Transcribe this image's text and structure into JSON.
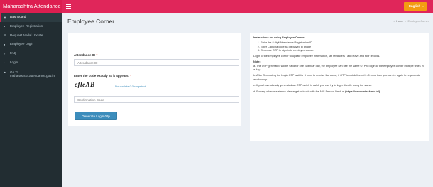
{
  "header": {
    "brand": "Maharashtra Attendance",
    "language": "English"
  },
  "sidebar": {
    "items": [
      {
        "label": "Dashboard",
        "icon": "dashboard-icon"
      },
      {
        "label": "Employee Registration",
        "icon": "users-icon"
      },
      {
        "label": "Request Nodal Update",
        "icon": "list-icon"
      },
      {
        "label": "Employee Login",
        "icon": "user-icon"
      },
      {
        "label": "FAQ",
        "icon": "question-icon"
      },
      {
        "label": "Login",
        "icon": "chevron-icon"
      },
      {
        "label_line1": "Go To",
        "label_line2": "maharashtra.attendance.gov.in",
        "icon": "globe-icon"
      }
    ]
  },
  "page": {
    "title": "Employee Corner",
    "breadcrumb": {
      "home": "Home",
      "current": "Employee Corner"
    }
  },
  "form": {
    "attendance_id_label": "Attendance ID",
    "attendance_id_placeholder": "Attendance ID",
    "captcha_label": "Enter the code exactly as it appears:",
    "captcha_text": "efleAB",
    "captcha_refresh": "Not readable? Change text",
    "confirmation_placeholder": "Confirmation Code",
    "submit_label": "Generate Login Otp",
    "required_mark": "*"
  },
  "instructions": {
    "title": "Instructions for using Employee Corner:",
    "steps": [
      "Enter the 8 digit Attendance/Registration ID.",
      "Enter Captcha code as displayed in image",
      "Generate OTP to sign in to employee corner."
    ],
    "login_text": "Login to the Employee corner to update employee information, set reminders , add leave and tour records.",
    "note_title": "Note:",
    "note_a": "a. The OTP generated will be valid for one calendar day, the employee can use the same OTP to login to the employee corner multiple times in a day.",
    "note_b": "b. After Generating the Login OTP wait for 5 mins to receive the same, if OTP is not delivered in 5 mins then you can try again to regenerate another otp.",
    "note_c": "c. If you have already generated an OTP which is valid, you can try to login directly using the same.",
    "note_d_prefix": "d. For any other assistance please get in touch with the NIC Service Desk at ",
    "note_d_link": "(https://servicedesk.nic.in/)"
  }
}
